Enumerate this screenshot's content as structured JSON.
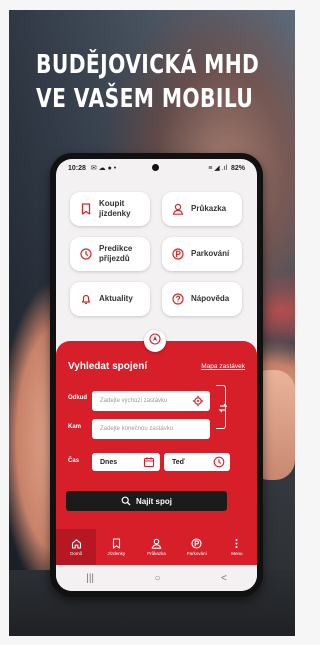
{
  "headline": {
    "line1": "BUDĚJOVICKÁ MHD",
    "line2": "VE VAŠEM MOBILU"
  },
  "statusbar": {
    "time": "10:28",
    "left_icons": "✉ ☁ ● •",
    "right_icons": "≡ ◢ .ıl",
    "battery": "82%"
  },
  "tiles": [
    {
      "label": "Koupit jízdenky",
      "icon": "bookmark-icon"
    },
    {
      "label": "Průkazka",
      "icon": "user-icon"
    },
    {
      "label": "Predikce příjezdů",
      "icon": "clock-icon"
    },
    {
      "label": "Parkování",
      "icon": "parking-icon"
    },
    {
      "label": "Aktuality",
      "icon": "bell-icon"
    },
    {
      "label": "Nápověda",
      "icon": "help-icon"
    }
  ],
  "search": {
    "title": "Vyhledat spojení",
    "map_link": "Mapa zastávek",
    "from_label": "Odkud",
    "from_placeholder": "Zadejte výchozí zastávku",
    "to_label": "Kam",
    "to_placeholder": "Zadejte konečnou zastávku",
    "time_label": "Čas",
    "date_value": "Dnes",
    "time_value": "Teď",
    "button_label": "Najít spoj"
  },
  "bottom_nav": [
    {
      "label": "Domů",
      "icon": "home-icon",
      "active": true
    },
    {
      "label": "Jízdenky",
      "icon": "ticket-icon",
      "active": false
    },
    {
      "label": "Průkazka",
      "icon": "user-icon",
      "active": false
    },
    {
      "label": "Parkování",
      "icon": "parking-icon",
      "active": false
    },
    {
      "label": "Menu",
      "icon": "dots-icon",
      "active": false
    }
  ],
  "system_nav": {
    "recent": "|||",
    "home": "○",
    "back": "<"
  },
  "colors": {
    "accent": "#d71f2a",
    "dark": "#1b1b1b",
    "tile_bg": "#ffffff"
  }
}
